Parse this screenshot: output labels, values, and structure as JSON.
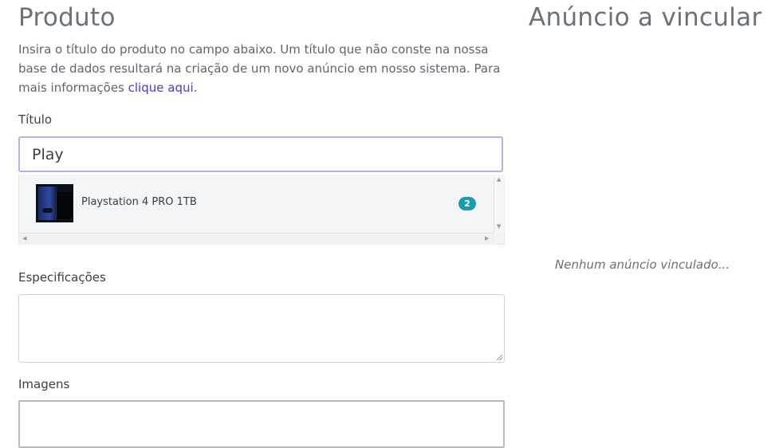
{
  "product": {
    "heading": "Produto",
    "intro_text": "Insira o título do produto no campo abaixo. Um título que não conste na nossa base de dados resultará na criação de um novo anúncio em nosso sistema. Para mais informações ",
    "intro_link": "clique aqui",
    "intro_end": ".",
    "title_label": "Título",
    "title_value": "Play",
    "suggestions": [
      {
        "label": "Playstation 4 PRO 1TB",
        "count": "2",
        "icon": "ps4-pro-thumbnail"
      }
    ],
    "specs_label": "Especificações",
    "images_label": "Imagens"
  },
  "link_panel": {
    "heading": "Anúncio a vincular",
    "empty_message": "Nenhum anúncio vinculado..."
  }
}
